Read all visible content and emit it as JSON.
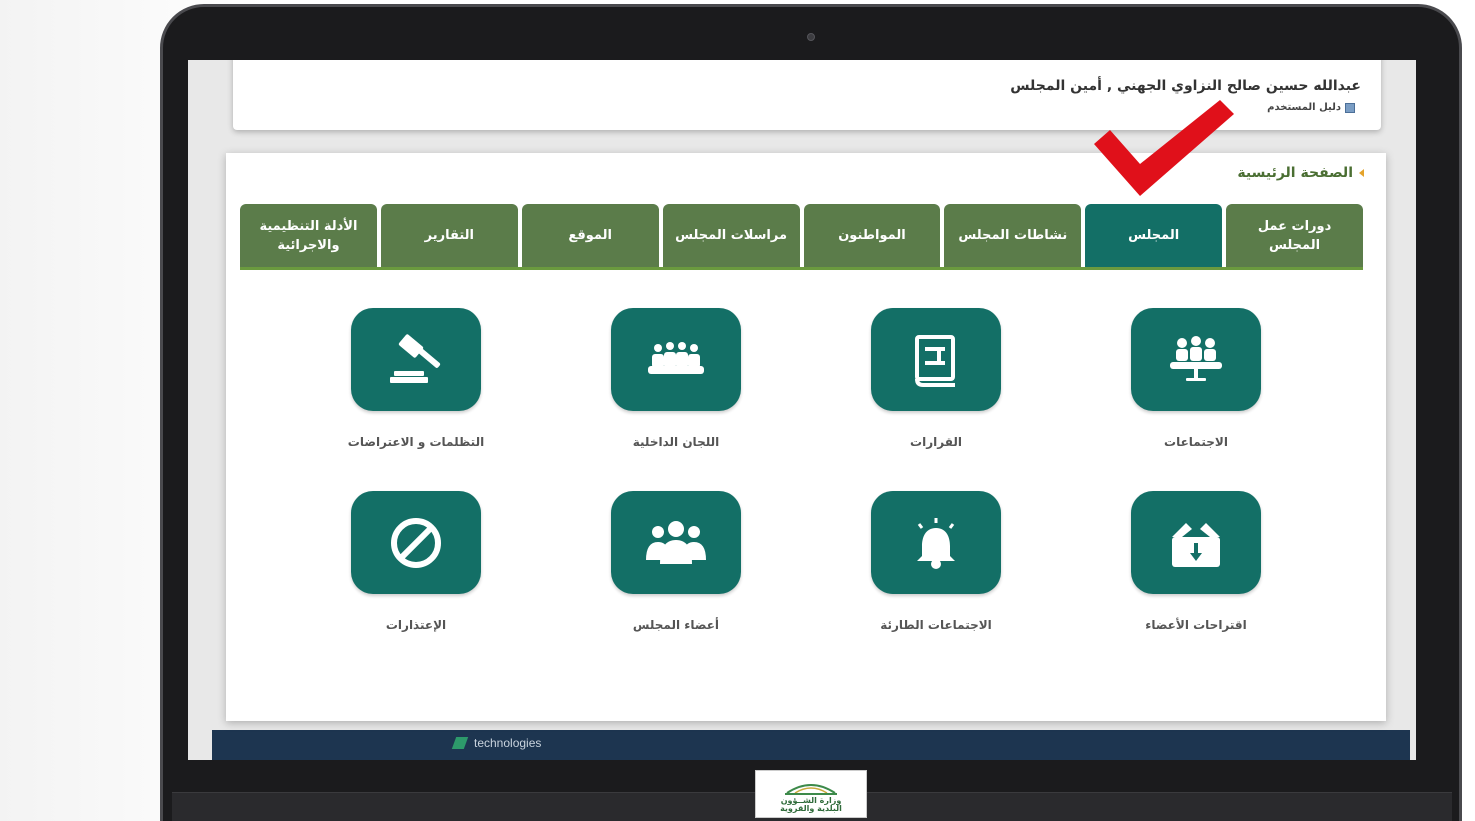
{
  "user": {
    "name": "عبدالله حسين صالح النزاوي الجهني , أمين المجلس",
    "guide_label": "دليل المستخدم"
  },
  "breadcrumb": {
    "label": "الصفحة الرئيسية"
  },
  "tabs": [
    {
      "label": "دورات عمل المجلس",
      "active": false
    },
    {
      "label": "المجلس",
      "active": true
    },
    {
      "label": "نشاطات المجلس",
      "active": false
    },
    {
      "label": "المواطنون",
      "active": false
    },
    {
      "label": "مراسلات المجلس",
      "active": false
    },
    {
      "label": "الموقع",
      "active": false
    },
    {
      "label": "التقارير",
      "active": false
    },
    {
      "label": "الأدلة التنظيمية والاجرائية",
      "active": false
    }
  ],
  "tiles": [
    {
      "label": "الاجتماعات",
      "icon": "meeting-icon"
    },
    {
      "label": "القرارات",
      "icon": "decisions-icon"
    },
    {
      "label": "اللجان الداخلية",
      "icon": "committees-icon"
    },
    {
      "label": "التظلمات و الاعتراضات",
      "icon": "gavel-icon"
    },
    {
      "label": "اقتراحات الأعضاء",
      "icon": "suggestion-box-icon"
    },
    {
      "label": "الاجتماعات الطارئة",
      "icon": "alarm-bell-icon"
    },
    {
      "label": "أعضاء المجلس",
      "icon": "members-icon"
    },
    {
      "label": "الإعتذارات",
      "icon": "prohibited-icon"
    }
  ],
  "footer": {
    "brand": "technologies"
  },
  "logo": {
    "text_line1": "وزارة الشــؤون",
    "text_line2": "البلدية والقروية"
  },
  "colors": {
    "tab": "#5b7c4a",
    "tab_active": "#136f66",
    "tile": "#136f66",
    "accent_check": "#e0101a"
  }
}
